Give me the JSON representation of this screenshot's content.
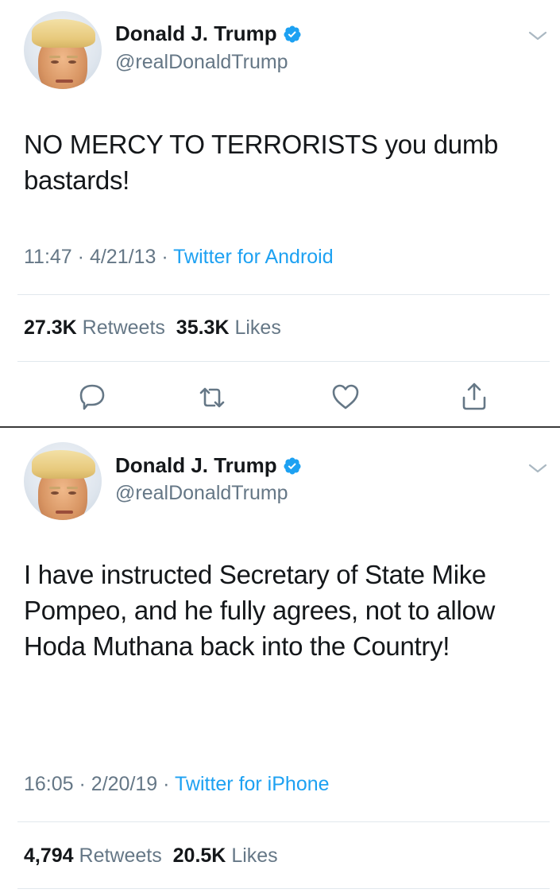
{
  "tweets": [
    {
      "author": {
        "name": "Donald J. Trump",
        "handle": "@realDonaldTrump",
        "verified": true
      },
      "text": "NO MERCY TO TERRORISTS you dumb bastards!",
      "time": "11:47",
      "date": "4/21/13",
      "source": "Twitter for Android",
      "retweets": "27.3K",
      "retweets_label": "Retweets",
      "likes": "35.3K",
      "likes_label": "Likes"
    },
    {
      "author": {
        "name": "Donald J. Trump",
        "handle": "@realDonaldTrump",
        "verified": true
      },
      "text": "I have instructed Secretary of State Mike Pompeo, and he fully agrees, not to allow Hoda Muthana back into the Country!",
      "time": "16:05",
      "date": "2/20/19",
      "source": "Twitter for iPhone",
      "retweets": "4,794",
      "retweets_label": "Retweets",
      "likes": "20.5K",
      "likes_label": "Likes"
    }
  ],
  "icons": {
    "verified": "verified-badge-icon",
    "menu": "chevron-down-icon",
    "reply": "reply-icon",
    "retweet": "retweet-icon",
    "like": "heart-icon",
    "share": "share-icon"
  },
  "colors": {
    "accent": "#1da1f2",
    "text": "#14171a",
    "secondary": "#657786",
    "divider": "#e1e8ed"
  }
}
